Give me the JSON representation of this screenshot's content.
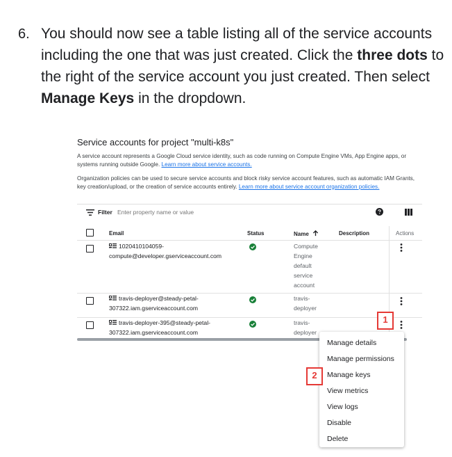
{
  "instruction": {
    "number": "6.",
    "part1": "You should now see a table listing all of the service accounts including the one that was just created. Click the ",
    "bold1": "three dots",
    "part2": " to the right of the service account you just created. Then select ",
    "bold2": "Manage Keys",
    "part3": " in the dropdown."
  },
  "screenshot": {
    "title": "Service accounts for project \"multi-k8s\"",
    "description1": "A service account represents a Google Cloud service identity, such as code running on Compute Engine VMs, App Engine apps, or systems running outside Google. ",
    "link1": "Learn more about service accounts.",
    "description2": "Organization policies can be used to secure service accounts and block risky service account features, such as automatic IAM Grants, key creation/upload, or the creation of service accounts entirely. ",
    "link2": "Learn more about service account organization policies.",
    "filter": {
      "label": "Filter",
      "placeholder": "Enter property name or value"
    },
    "columns": {
      "email": "Email",
      "status": "Status",
      "name": "Name",
      "description": "Description",
      "actions": "Actions"
    },
    "rows": [
      {
        "email_line1": "1020410104059-",
        "email_line2": "compute@developer.gserviceaccount.com",
        "name_lines": [
          "Compute",
          "Engine",
          "default",
          "service",
          "account"
        ]
      },
      {
        "email_line1": "travis-deployer@steady-petal-",
        "email_line2": "307322.iam.gserviceaccount.com",
        "name_lines": [
          "travis-",
          "deployer"
        ]
      },
      {
        "email_line1": "travis-deployer-395@steady-petal-",
        "email_line2": "307322.iam.gserviceaccount.com",
        "name_lines": [
          "travis-",
          "deployer"
        ]
      }
    ],
    "menu": [
      "Manage details",
      "Manage permissions",
      "Manage keys",
      "View metrics",
      "View logs",
      "Disable",
      "Delete"
    ],
    "callouts": [
      "1",
      "2"
    ],
    "colors": {
      "link": "#1a73e8",
      "status_ok": "#188038",
      "callout": "#e53935"
    }
  }
}
